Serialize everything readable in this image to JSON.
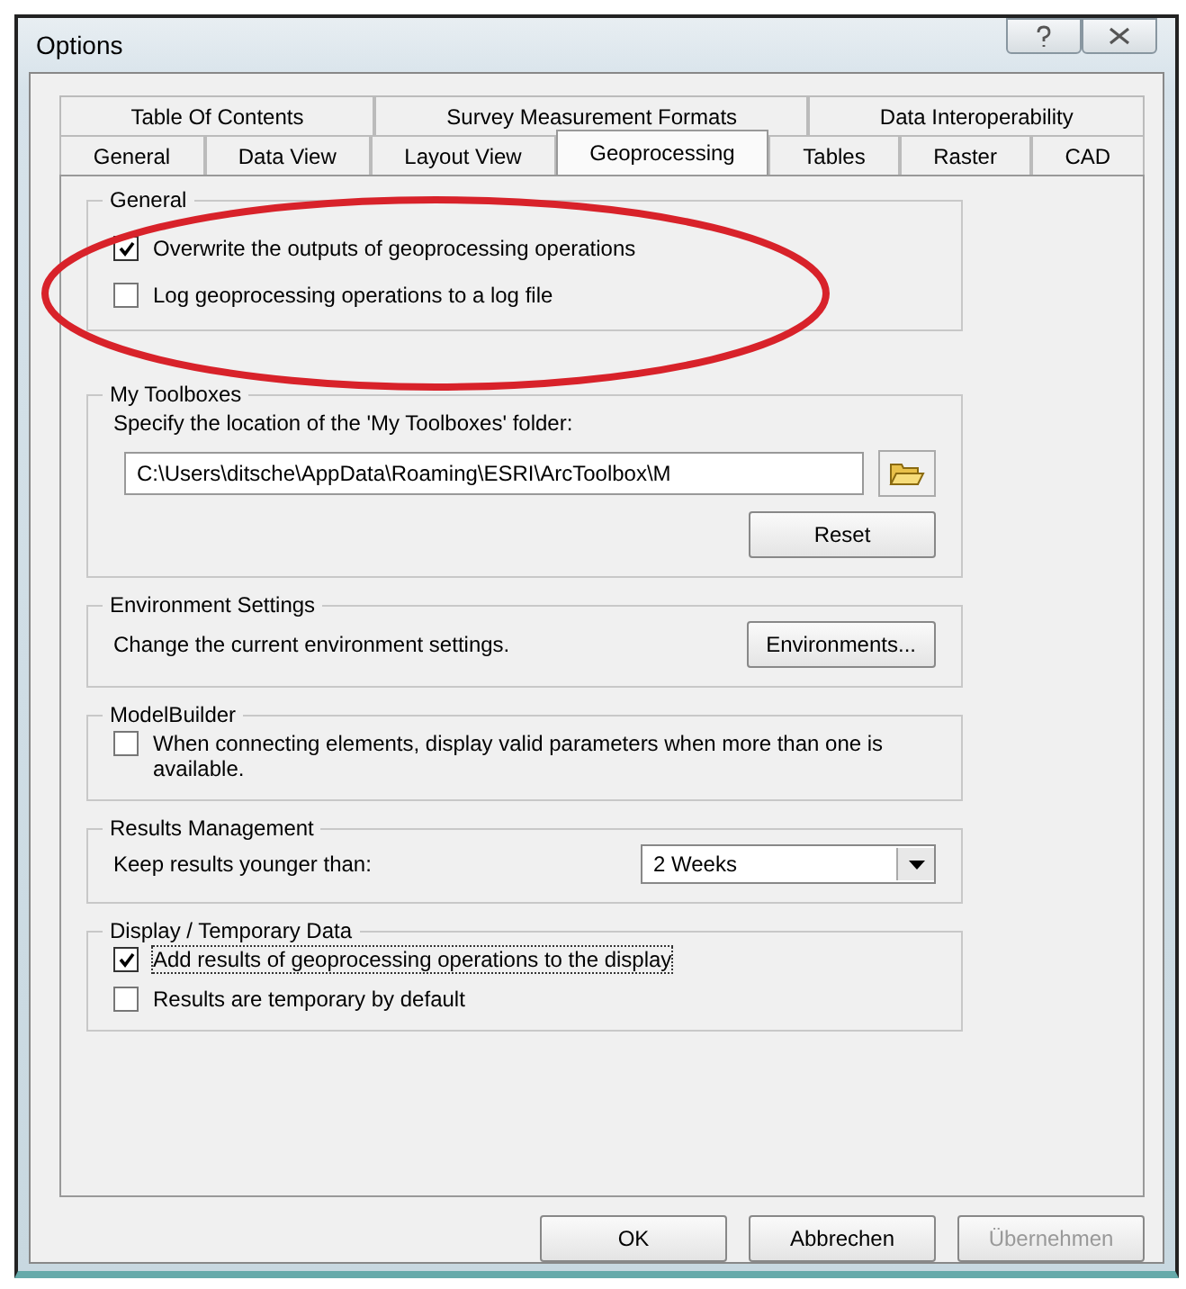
{
  "window": {
    "title": "Options"
  },
  "tab_rows": [
    [
      {
        "label": "Table Of Contents",
        "selected": false
      },
      {
        "label": "Survey Measurement Formats",
        "selected": false
      },
      {
        "label": "Data Interoperability",
        "selected": false
      }
    ],
    [
      {
        "label": "General",
        "selected": false
      },
      {
        "label": "Data View",
        "selected": false
      },
      {
        "label": "Layout View",
        "selected": false
      },
      {
        "label": "Geoprocessing",
        "selected": true
      },
      {
        "label": "Tables",
        "selected": false
      },
      {
        "label": "Raster",
        "selected": false
      },
      {
        "label": "CAD",
        "selected": false
      }
    ]
  ],
  "general": {
    "title": "General",
    "options": [
      {
        "label": "Overwrite the outputs of geoprocessing operations",
        "checked": true
      },
      {
        "label": "Log geoprocessing operations to a log file",
        "checked": false
      }
    ]
  },
  "my_toolboxes": {
    "title": "My Toolboxes",
    "prompt": "Specify the location of the 'My Toolboxes' folder:",
    "path": "C:\\Users\\ditsche\\AppData\\Roaming\\ESRI\\ArcToolbox\\M",
    "reset": "Reset"
  },
  "environment_settings": {
    "title": "Environment Settings",
    "text": "Change the current environment settings.",
    "button": "Environments..."
  },
  "modelbuilder": {
    "title": "ModelBuilder",
    "option": {
      "label": "When connecting elements, display valid parameters when more than one is available.",
      "checked": false
    }
  },
  "results_management": {
    "title": "Results Management",
    "label": "Keep results younger than:",
    "value": "2 Weeks"
  },
  "display_temporary": {
    "title": "Display / Temporary Data",
    "options": [
      {
        "label": "Add results of geoprocessing operations to the display",
        "checked": true
      },
      {
        "label": "Results are temporary by default",
        "checked": false
      }
    ]
  },
  "buttons": [
    {
      "label": "OK",
      "disabled": false
    },
    {
      "label": "Abbrechen",
      "disabled": false
    },
    {
      "label": "Übernehmen",
      "disabled": true
    }
  ]
}
